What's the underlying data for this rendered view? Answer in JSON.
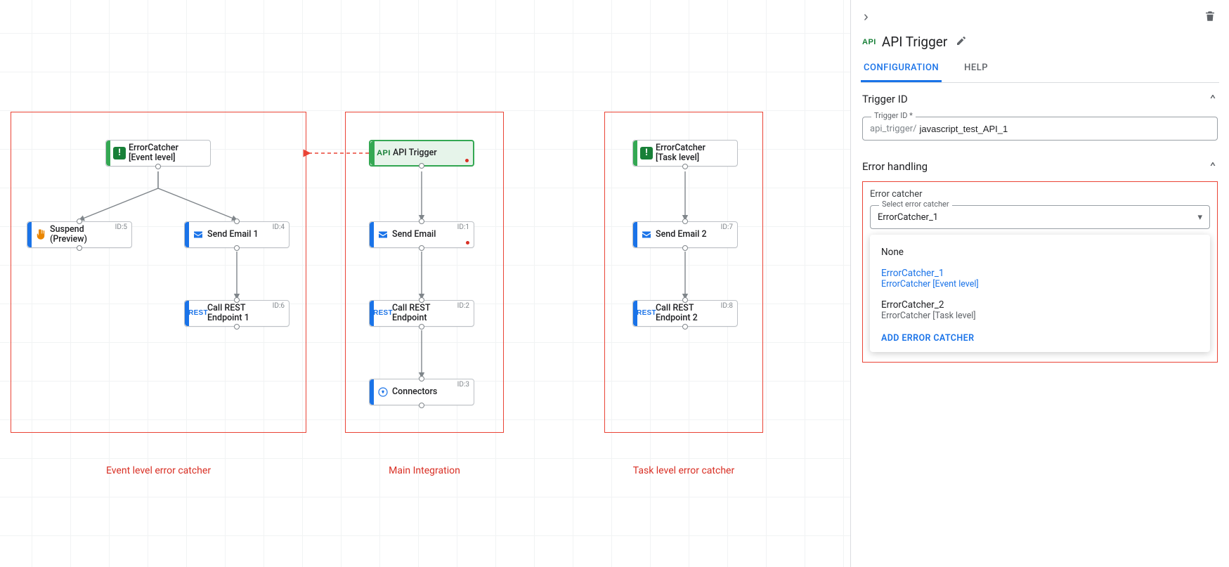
{
  "canvas": {
    "sections": {
      "event": {
        "caption": "Event level error catcher"
      },
      "main": {
        "caption": "Main Integration"
      },
      "task": {
        "caption": "Task level error catcher"
      }
    },
    "nodes": {
      "ecEvent": {
        "label": "ErrorCatcher\n[Event level]"
      },
      "suspend": {
        "label": "Suspend\n(Preview)",
        "id": "ID:5"
      },
      "sendEmail1": {
        "label": "Send Email 1",
        "id": "ID:4"
      },
      "callRest1": {
        "label": "Call REST\nEndpoint 1",
        "id": "ID:6"
      },
      "apiTrigger": {
        "label": "API Trigger"
      },
      "sendEmail": {
        "label": "Send Email",
        "id": "ID:1"
      },
      "callRest": {
        "label": "Call REST\nEndpoint",
        "id": "ID:2"
      },
      "connectors": {
        "label": "Connectors",
        "id": "ID:3"
      },
      "ecTask": {
        "label": "ErrorCatcher\n[Task level]"
      },
      "sendEmail2": {
        "label": "Send Email 2",
        "id": "ID:7"
      },
      "callRest2": {
        "label": "Call REST\nEndpoint 2",
        "id": "ID:8"
      }
    }
  },
  "panel": {
    "title": "API Trigger",
    "tabs": {
      "config": "CONFIGURATION",
      "help": "HELP"
    },
    "trigger_id": {
      "heading": "Trigger ID",
      "legend": "Trigger ID *",
      "prefix": "api_trigger/",
      "value": "javascript_test_API_1"
    },
    "error_handling": {
      "heading": "Error handling",
      "label": "Error catcher",
      "select_legend": "Select error catcher",
      "selected_value": "ErrorCatcher_1",
      "options": {
        "none": {
          "title": "None"
        },
        "opt1": {
          "title": "ErrorCatcher_1",
          "sub": "ErrorCatcher [Event level]"
        },
        "opt2": {
          "title": "ErrorCatcher_2",
          "sub": "ErrorCatcher [Task level]"
        }
      },
      "add_label": "ADD ERROR CATCHER"
    }
  }
}
